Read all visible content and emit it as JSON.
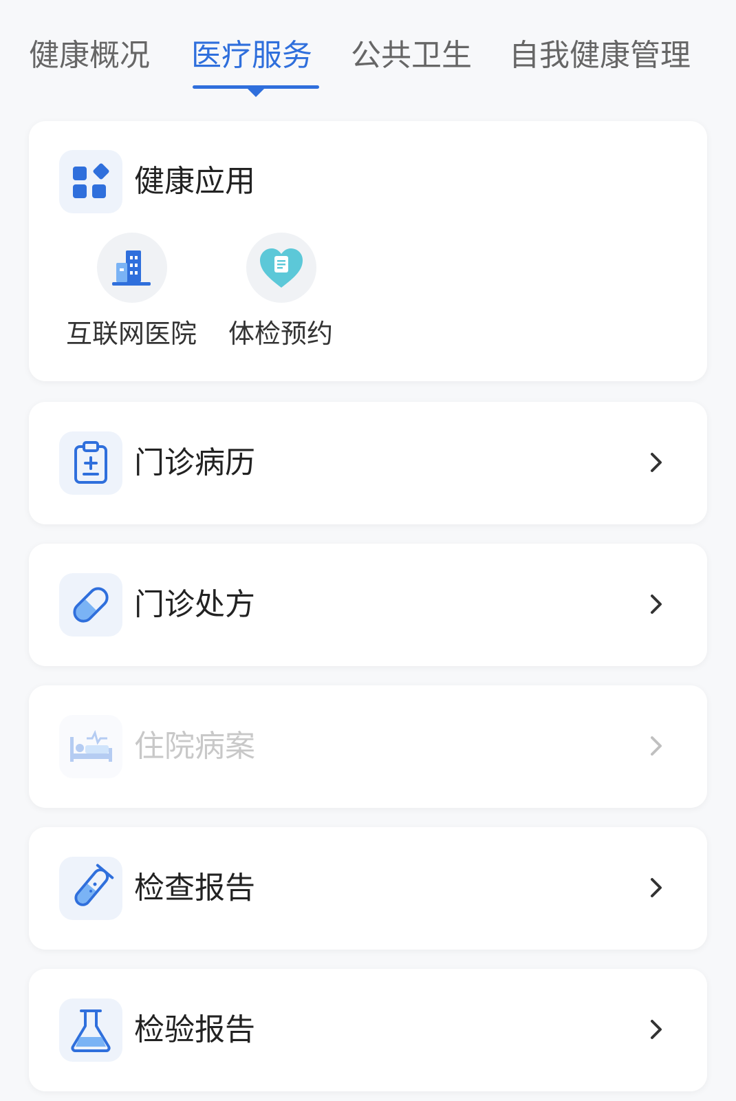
{
  "tabs": [
    {
      "label": "健康概况",
      "active": false
    },
    {
      "label": "医疗服务",
      "active": true
    },
    {
      "label": "公共卫生",
      "active": false
    },
    {
      "label": "自我健康管理",
      "active": false
    }
  ],
  "apps_section": {
    "title": "健康应用",
    "items": [
      {
        "label": "互联网医院",
        "icon": "hospital-building-icon"
      },
      {
        "label": "体检预约",
        "icon": "heart-document-icon"
      }
    ]
  },
  "rows": [
    {
      "label": "门诊病历",
      "icon": "clipboard-icon",
      "enabled": true
    },
    {
      "label": "门诊处方",
      "icon": "pill-icon",
      "enabled": true
    },
    {
      "label": "住院病案",
      "icon": "hospital-bed-icon",
      "enabled": false
    },
    {
      "label": "检查报告",
      "icon": "test-tube-icon",
      "enabled": true
    },
    {
      "label": "检验报告",
      "icon": "flask-icon",
      "enabled": true
    }
  ],
  "colors": {
    "accent": "#2f6fdc",
    "icon_light_blue": "#7ab3f5",
    "teal": "#5cc8d8",
    "background": "#f7f8fa"
  }
}
